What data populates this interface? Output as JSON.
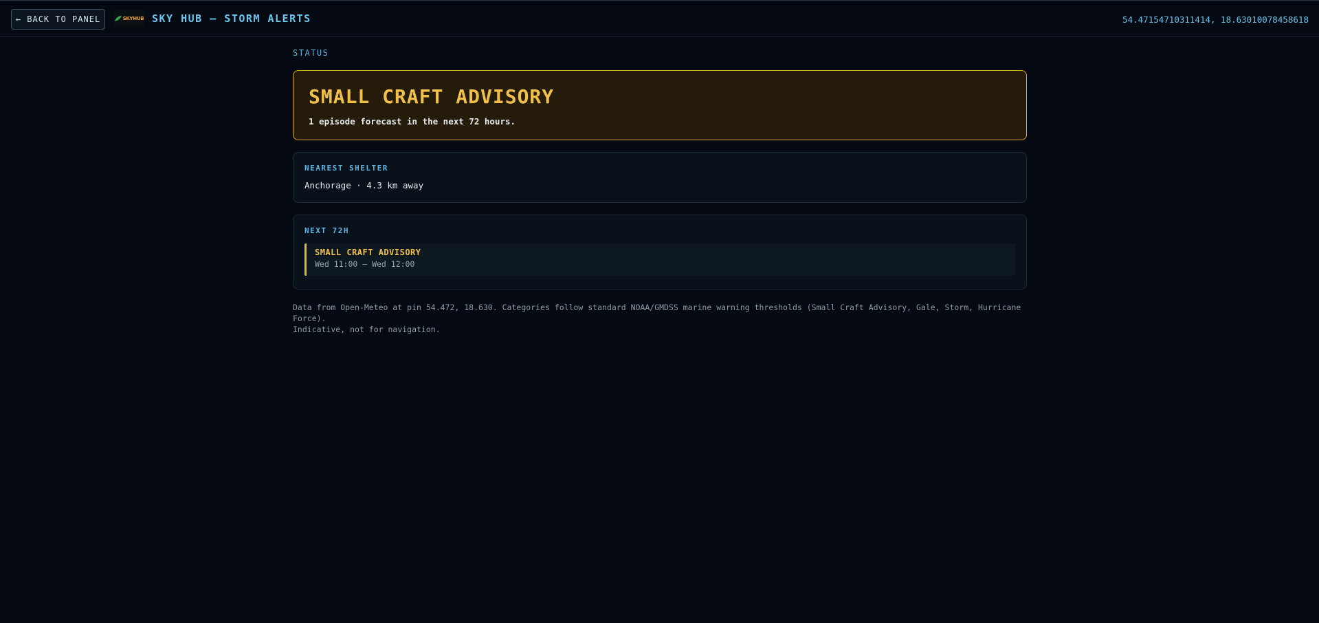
{
  "header": {
    "back_label": "← BACK TO PANEL",
    "logo_text": "SKYHUB",
    "title": "SKY HUB — STORM ALERTS",
    "coordinates": "54.47154710311414, 18.63010078458618"
  },
  "status": {
    "section_label": "STATUS",
    "title": "SMALL CRAFT ADVISORY",
    "subtitle": "1 episode forecast in the next 72 hours."
  },
  "shelter": {
    "label": "NEAREST SHELTER",
    "text": "Anchorage · 4.3 km away"
  },
  "next72": {
    "label": "NEXT 72H",
    "episodes": [
      {
        "title": "SMALL CRAFT ADVISORY",
        "time": "Wed 11:00 – Wed 12:00"
      }
    ]
  },
  "footnote": {
    "line1": "Data from Open-Meteo at pin 54.472, 18.630. Categories follow standard NOAA/GMDSS marine warning thresholds (Small Craft Advisory, Gale, Storm, Hurricane Force).",
    "line2": "Indicative, not for navigation."
  },
  "colors": {
    "accent": "#6cc6ee",
    "advisory": "#f0c04a",
    "background": "#050911"
  }
}
